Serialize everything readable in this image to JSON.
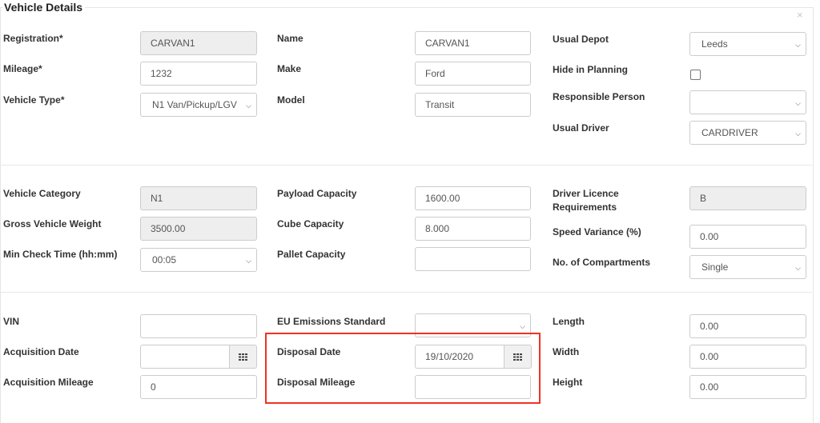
{
  "section": {
    "title": "Vehicle Details",
    "close_glyph": "×"
  },
  "col1": {
    "registration": {
      "label": "Registration*",
      "value": "CARVAN1"
    },
    "mileage": {
      "label": "Mileage*",
      "value": "1232"
    },
    "vehicle_type": {
      "label": "Vehicle Type*",
      "value": "N1 Van/Pickup/LGV"
    },
    "vehicle_category": {
      "label": "Vehicle Category",
      "value": "N1"
    },
    "gross_weight": {
      "label": "Gross Vehicle Weight",
      "value": "3500.00"
    },
    "min_check_time": {
      "label": "Min Check Time (hh:mm)",
      "value": "00:05"
    },
    "vin": {
      "label": "VIN",
      "value": ""
    },
    "acquisition_date": {
      "label": "Acquisition Date",
      "value": ""
    },
    "acquisition_mileage": {
      "label": "Acquisition Mileage",
      "value": "0"
    }
  },
  "col2": {
    "name": {
      "label": "Name",
      "value": "CARVAN1"
    },
    "make": {
      "label": "Make",
      "value": "Ford"
    },
    "model": {
      "label": "Model",
      "value": "Transit"
    },
    "payload_capacity": {
      "label": "Payload Capacity",
      "value": "1600.00"
    },
    "cube_capacity": {
      "label": "Cube Capacity",
      "value": "8.000"
    },
    "pallet_capacity": {
      "label": "Pallet Capacity",
      "value": ""
    },
    "eu_emissions": {
      "label": "EU Emissions Standard",
      "value": ""
    },
    "disposal_date": {
      "label": "Disposal Date",
      "value": "19/10/2020"
    },
    "disposal_mileage": {
      "label": "Disposal Mileage",
      "value": ""
    }
  },
  "col3": {
    "usual_depot": {
      "label": "Usual Depot",
      "value": "Leeds"
    },
    "hide_in_planning": {
      "label": "Hide in Planning",
      "checked": false
    },
    "responsible_person": {
      "label": "Responsible Person",
      "value": ""
    },
    "usual_driver": {
      "label": "Usual Driver",
      "value": "CARDRIVER"
    },
    "driver_licence": {
      "label_line1": "Driver Licence",
      "label_line2": "Requirements",
      "value": "B"
    },
    "speed_variance": {
      "label": "Speed Variance (%)",
      "value": "0.00"
    },
    "compartments": {
      "label": "No. of Compartments",
      "value": "Single"
    },
    "length": {
      "label": "Length",
      "value": "0.00"
    },
    "width": {
      "label": "Width",
      "value": "0.00"
    },
    "height": {
      "label": "Height",
      "value": "0.00"
    }
  },
  "colors": {
    "highlight": "#ee3322",
    "readonly_bg": "#eeeeee",
    "border": "#cccccc"
  }
}
